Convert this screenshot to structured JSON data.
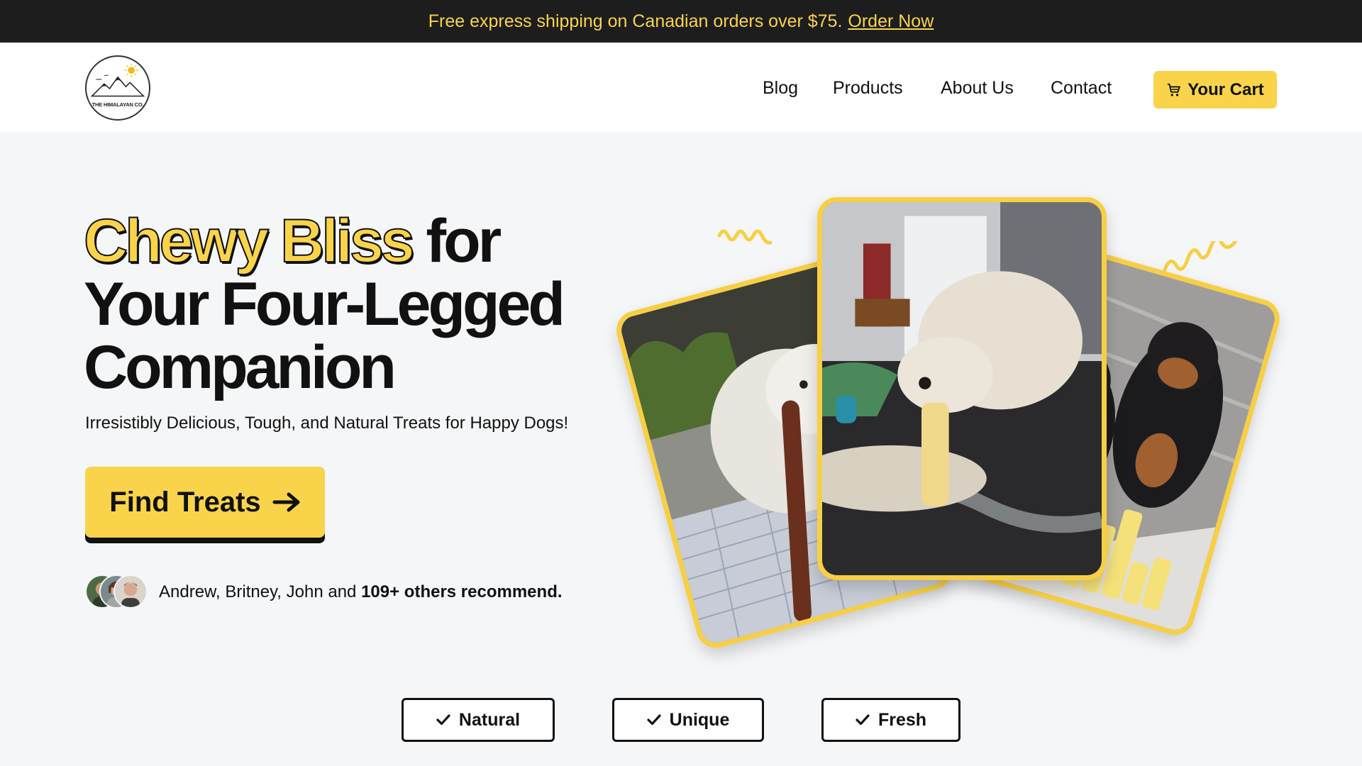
{
  "banner": {
    "text": "Free express shipping on Canadian orders over $75.",
    "link": "Order Now"
  },
  "header": {
    "logo_text": "THE HIMALAYAN CO.",
    "nav": [
      "Blog",
      "Products",
      "About Us",
      "Contact"
    ],
    "cart_label": "Your Cart"
  },
  "hero": {
    "title_highlight": "Chewy Bliss",
    "title_rest_1": " for",
    "title_line_2": "Your Four-Legged",
    "title_line_3": "Companion",
    "subtitle": "Irresistibly Delicious, Tough, and Natural Treats for Happy Dogs!",
    "cta_label": "Find Treats"
  },
  "social_proof": {
    "names": "Andrew, Britney, John and ",
    "count": "109+ others recommend."
  },
  "badges": [
    "Natural",
    "Unique",
    "Fresh"
  ],
  "icons": {
    "cart": "cart-icon",
    "arrow": "arrow-right-icon",
    "check": "check-icon"
  },
  "colors": {
    "accent": "#f9d44a",
    "banner_bg": "#1d1d1d",
    "page_bg": "#f5f6f8"
  }
}
